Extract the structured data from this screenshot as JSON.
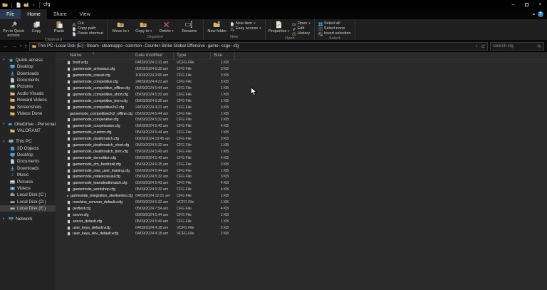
{
  "theme": {
    "accent_blue": "#4ca3e0",
    "folder_yellow": "#dcb667",
    "help_blue": "#2f86c9",
    "delete_red": "#d9645f",
    "check_orange": "#e6913c",
    "selection_grey": "#3c3c3c"
  },
  "window": {
    "title": "cfg",
    "qat_icons": [
      "explorer-icon",
      "properties-icon",
      "new-folder-icon"
    ],
    "controls": [
      "minimize-icon",
      "maximize-icon",
      "close-icon"
    ],
    "collapse_ribbon_icon": "collapse-ribbon-icon",
    "help_icon": "help-icon"
  },
  "tabs": [
    {
      "label": "File",
      "type": "menu"
    },
    {
      "label": "Home",
      "active": true
    },
    {
      "label": "Share"
    },
    {
      "label": "View"
    }
  ],
  "ribbon": {
    "groups": [
      {
        "label": "Clipboard",
        "large": [
          {
            "label": "Pin to Quick access",
            "icon": "pin-icon"
          },
          {
            "label": "Copy",
            "icon": "copy-icon"
          },
          {
            "label": "Paste",
            "icon": "paste-icon"
          }
        ],
        "small": [
          {
            "label": "Cut",
            "icon": "cut-icon"
          },
          {
            "label": "Copy path",
            "icon": "copy-path-icon"
          },
          {
            "label": "Paste shortcut",
            "icon": "paste-shortcut-icon"
          }
        ]
      },
      {
        "label": "Organize",
        "large": [
          {
            "label": "Move to",
            "icon": "move-to-icon",
            "dropdown": true
          },
          {
            "label": "Copy to",
            "icon": "copy-to-icon",
            "dropdown": true
          },
          {
            "label": "Delete",
            "icon": "delete-icon",
            "dropdown": true
          },
          {
            "label": "Rename",
            "icon": "rename-icon"
          }
        ],
        "small": []
      },
      {
        "label": "New",
        "large": [
          {
            "label": "New folder",
            "icon": "new-folder-icon"
          }
        ],
        "small": [
          {
            "label": "New item",
            "icon": "new-item-icon",
            "dropdown": true
          },
          {
            "label": "Easy access",
            "icon": "easy-access-icon",
            "dropdown": true
          }
        ]
      },
      {
        "label": "Open",
        "large": [
          {
            "label": "Properties",
            "icon": "properties-icon",
            "dropdown": true
          }
        ],
        "small": [
          {
            "label": "Open",
            "icon": "open-icon",
            "dropdown": true
          },
          {
            "label": "Edit",
            "icon": "edit-icon"
          },
          {
            "label": "History",
            "icon": "history-icon"
          }
        ]
      },
      {
        "label": "Select",
        "large": [],
        "small": [
          {
            "label": "Select all",
            "icon": "select-all-icon"
          },
          {
            "label": "Select none",
            "icon": "select-none-icon"
          },
          {
            "label": "Invert selection",
            "icon": "invert-selection-icon"
          }
        ]
      }
    ]
  },
  "addressbar": {
    "nav_icons": [
      "back-icon",
      "forward-icon",
      "dropdown-icon",
      "up-icon"
    ],
    "location_icon": "folder-icon",
    "breadcrumb": [
      "This PC",
      "Local Disk (E:)",
      "Steam",
      "steamapps",
      "common",
      "Counter-Strike Global Offensive",
      "game",
      "csgo",
      "cfg"
    ],
    "field_icons": [
      "dropdown-icon",
      "refresh-icon"
    ],
    "search": {
      "placeholder": "Search cfg",
      "icon": "search-icon"
    }
  },
  "sidebar": {
    "sections": [
      {
        "label": "Quick access",
        "icon": "quick-access-icon",
        "expanded": true,
        "items": [
          {
            "label": "Desktop",
            "icon": "desktop-icon",
            "pinned": true
          },
          {
            "label": "Downloads",
            "icon": "downloads-icon",
            "pinned": true
          },
          {
            "label": "Documents",
            "icon": "documents-icon",
            "pinned": true
          },
          {
            "label": "Pictures",
            "icon": "pictures-icon",
            "pinned": true
          },
          {
            "label": "Audio Visuals",
            "icon": "folder-icon"
          },
          {
            "label": "Reward Videos",
            "icon": "folder-icon"
          },
          {
            "label": "Screenshots",
            "icon": "folder-icon"
          },
          {
            "label": "Videos Done",
            "icon": "folder-icon"
          }
        ]
      },
      {
        "label": "OneDrive - Personal",
        "icon": "onedrive-icon",
        "expanded": true,
        "items": [
          {
            "label": "VALORANT",
            "icon": "folder-icon"
          }
        ]
      },
      {
        "label": "This PC",
        "icon": "this-pc-icon",
        "expanded": true,
        "items": [
          {
            "label": "3D Objects",
            "icon": "3d-objects-icon"
          },
          {
            "label": "Desktop",
            "icon": "desktop-icon"
          },
          {
            "label": "Documents",
            "icon": "documents-icon"
          },
          {
            "label": "Downloads",
            "icon": "downloads-icon"
          },
          {
            "label": "Music",
            "icon": "music-icon"
          },
          {
            "label": "Pictures",
            "icon": "pictures-icon"
          },
          {
            "label": "Videos",
            "icon": "videos-icon"
          },
          {
            "label": "Local Disk (C:)",
            "icon": "drive-c-icon"
          },
          {
            "label": "Local Disk (D:)",
            "icon": "drive-icon"
          },
          {
            "label": "Local Disk (E:)",
            "icon": "drive-icon",
            "selected": true
          }
        ]
      },
      {
        "label": "Network",
        "icon": "network-icon",
        "expanded": false,
        "items": []
      }
    ]
  },
  "filelist": {
    "columns": [
      "Name",
      "Date modified",
      "Type",
      "Size"
    ],
    "sort": {
      "column": "Name",
      "direction": "asc",
      "icon": "sort-ascending-icon"
    },
    "file_icon": "cfg-file-icon",
    "files": [
      {
        "name": "boot.vcfg",
        "date_modified": "04/09/2024 1:21 am",
        "type": "VCFG File",
        "size": "1 KB"
      },
      {
        "name": "gamemode_armsrace.cfg",
        "date_modified": "05/09/2024 5:32 am",
        "type": "CFG File",
        "size": "3 KB"
      },
      {
        "name": "gamemode_casual.cfg",
        "date_modified": "10/09/2024 2:00 am",
        "type": "CFG File",
        "size": "3 KB"
      },
      {
        "name": "gamemode_competitive.cfg",
        "date_modified": "24/09/2024 4:21 am",
        "type": "CFG File",
        "size": "3 KB"
      },
      {
        "name": "gamemode_competitive_offline.cfg",
        "date_modified": "05/09/2024 5:44 am",
        "type": "CFG File",
        "size": "1 KB"
      },
      {
        "name": "gamemode_competitive_short.cfg",
        "date_modified": "05/09/2024 5:32 am",
        "type": "CFG File",
        "size": "1 KB"
      },
      {
        "name": "gamemode_competitive_tmm.cfg",
        "date_modified": "05/09/2024 6:25 am",
        "type": "CFG File",
        "size": "1 KB"
      },
      {
        "name": "gamemode_competitive2v2.cfg",
        "date_modified": "24/09/2024 4:21 am",
        "type": "CFG File",
        "size": "3 KB"
      },
      {
        "name": "gamemode_competitive2v2_offline.cfg",
        "date_modified": "05/09/2024 5:44 am",
        "type": "CFG File",
        "size": "1 KB"
      },
      {
        "name": "gamemode_cooperative.cfg",
        "date_modified": "05/09/2024 5:32 am",
        "type": "CFG File",
        "size": "2 KB"
      },
      {
        "name": "gamemode_coopmission.cfg",
        "date_modified": "05/09/2024 5:43 am",
        "type": "CFG File",
        "size": "4 KB"
      },
      {
        "name": "gamemode_custom.cfg",
        "date_modified": "05/09/2024 5:44 am",
        "type": "CFG File",
        "size": "1 KB"
      },
      {
        "name": "gamemode_deathmatch.cfg",
        "date_modified": "06/09/2024 10:45 am",
        "type": "CFG File",
        "size": "3 KB"
      },
      {
        "name": "gamemode_deathmatch_short.cfg",
        "date_modified": "05/09/2024 5:32 am",
        "type": "CFG File",
        "size": "1 KB"
      },
      {
        "name": "gamemode_deathmatch_tmm.cfg",
        "date_modified": "05/09/2024 5:49 am",
        "type": "CFG File",
        "size": "1 KB"
      },
      {
        "name": "gamemode_demolition.cfg",
        "date_modified": "05/09/2024 5:43 am",
        "type": "CFG File",
        "size": "4 KB"
      },
      {
        "name": "gamemode_dm_freeforall.cfg",
        "date_modified": "05/09/2024 6:25 am",
        "type": "CFG File",
        "size": "3 KB"
      },
      {
        "name": "gamemode_new_user_training.cfg",
        "date_modified": "05/09/2024 5:44 am",
        "type": "CFG File",
        "size": "1 KB"
      },
      {
        "name": "gamemode_retakecasual.cfg",
        "date_modified": "05/09/2024 5:32 am",
        "type": "CFG File",
        "size": "3 KB"
      },
      {
        "name": "gamemode_teamdeathmatch.cfg",
        "date_modified": "05/09/2024 5:43 am",
        "type": "CFG File",
        "size": "4 KB"
      },
      {
        "name": "gamemode_workshop.cfg",
        "date_modified": "05/09/2024 5:32 am",
        "type": "CFG File",
        "size": "4 KB"
      },
      {
        "name": "gamestate_integration_steelseries.cfg",
        "date_modified": "04/09/2024 12:21 am",
        "type": "CFG File",
        "size": "1 KB"
      },
      {
        "name": "machine_convars_default.vcfg",
        "date_modified": "05/09/2024 5:32 am",
        "type": "VCFG File",
        "size": "1 KB"
      },
      {
        "name": "perftest.cfg",
        "date_modified": "05/09/2024 7:54 am",
        "type": "CFG File",
        "size": "4 KB"
      },
      {
        "name": "server.cfg",
        "date_modified": "05/09/2024 5:44 am",
        "type": "CFG File",
        "size": "1 KB"
      },
      {
        "name": "server_default.cfg",
        "date_modified": "05/09/2024 5:49 am",
        "type": "CFG File",
        "size": "1 KB"
      },
      {
        "name": "user_keys_default.vcfg",
        "date_modified": "04/09/2024 4:18 am",
        "type": "VCFG File",
        "size": "2 KB"
      },
      {
        "name": "user_keys_dev_default.vcfg",
        "date_modified": "04/09/2024 4:18 am",
        "type": "VCFG File",
        "size": "2 KB"
      }
    ]
  }
}
